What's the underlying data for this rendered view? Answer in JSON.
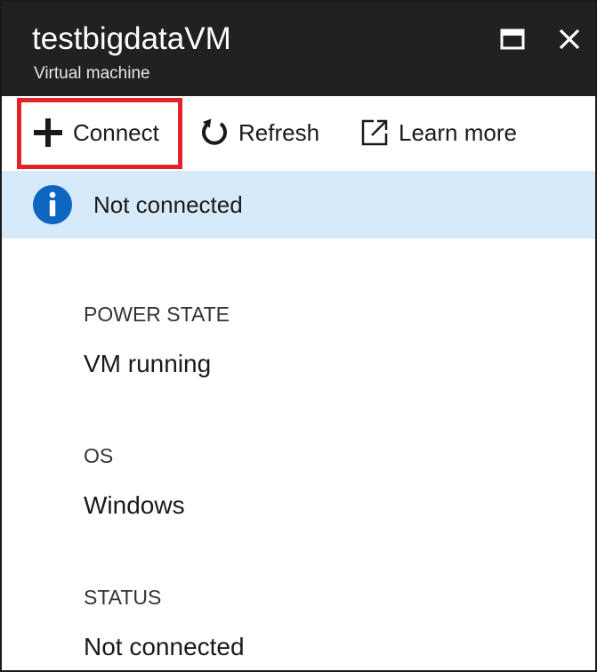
{
  "header": {
    "title": "testbigdataVM",
    "subtitle": "Virtual machine",
    "maximize_icon": "maximize-icon",
    "close_icon": "close-icon",
    "background": "#212121"
  },
  "toolbar": {
    "connect_label": "Connect",
    "connect_icon": "plus-icon",
    "refresh_label": "Refresh",
    "refresh_icon": "refresh-icon",
    "learn_more_label": "Learn more",
    "learn_more_icon": "external-link-icon",
    "highlight_color": "#e1242b"
  },
  "infobar": {
    "icon": "info-icon",
    "text": "Not connected",
    "background": "#d7eaf9",
    "icon_color": "#0d66c2"
  },
  "properties": [
    {
      "label": "POWER STATE",
      "value": "VM running"
    },
    {
      "label": "OS",
      "value": "Windows"
    },
    {
      "label": "STATUS",
      "value": "Not connected"
    }
  ]
}
